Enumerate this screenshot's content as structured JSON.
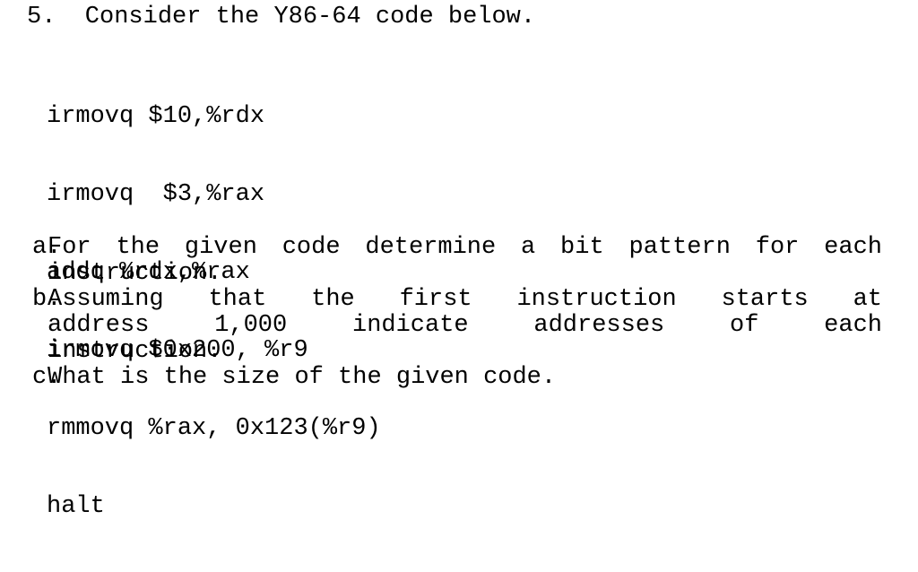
{
  "document": {
    "background_color": "#ffffff",
    "text_color": "#000000",
    "heading": "5.  Consider the Y86-64 code below."
  },
  "code_block": {
    "language": "Y86-64 assembly",
    "lines": [
      "irmovq $10,%rdx",
      "irmovq  $3,%rax",
      "addq %rdx,%rax",
      "irmovq $0x200, %r9",
      "rmmovq %rax, 0x123(%r9)",
      "halt"
    ]
  },
  "sub_questions": [
    {
      "marker": "a.",
      "line1": "For the given code determine a bit pattern for each",
      "line2": "instruction.",
      "full_text": "For the given code determine a bit pattern for each instruction."
    },
    {
      "marker": "b.",
      "line1": "Assuming that the first instruction starts at",
      "line2": "address 1,000 indicate addresses of each",
      "line3": "instruction.",
      "full_text": "Assuming that the first instruction starts at address 1,000 indicate addresses of each instruction."
    },
    {
      "marker": "c.",
      "line1": "What is the size of the given code.",
      "full_text": "What is the size of the given code."
    }
  ]
}
